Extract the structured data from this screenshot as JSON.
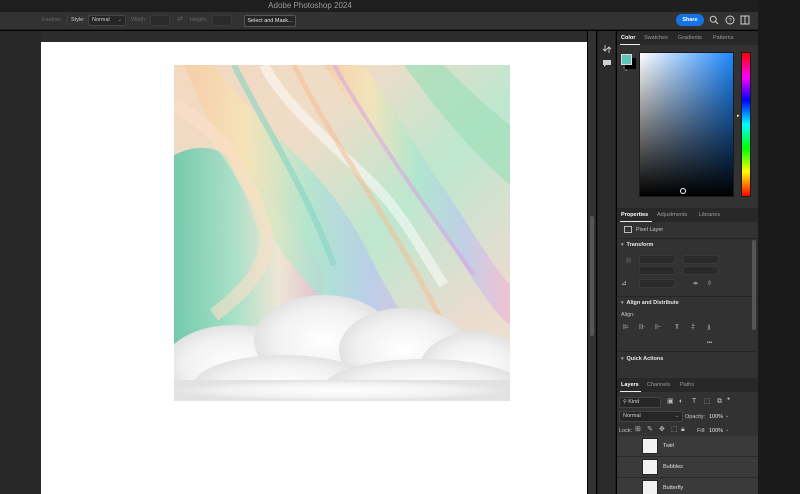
{
  "app": {
    "title": "Adobe Photoshop 2024"
  },
  "options_bar": {
    "feather_label": "Feather:",
    "style_label": "Style:",
    "style_value": "Normal",
    "width_label": "Width:",
    "height_label": "Height:",
    "select_mask_label": "Select and Mask...",
    "share_label": "Share"
  },
  "color_panel": {
    "tabs": [
      "Color",
      "Swatches",
      "Gradients",
      "Patterns"
    ],
    "active_tab": "Color",
    "foreground_color": "#5fc4b8",
    "background_color": "#000000",
    "hue_color": "#1e88ff"
  },
  "properties_panel": {
    "tabs": [
      "Properties",
      "Adjustments",
      "Libraries"
    ],
    "active_tab": "Properties",
    "layer_type": "Pixel Layer",
    "transform_label": "Transform",
    "align_label": "Align and Distribute",
    "align_sub": "Align:",
    "quick_actions_label": "Quick Actions",
    "more": "•••"
  },
  "layers_panel": {
    "tabs": [
      "Layers",
      "Channels",
      "Paths"
    ],
    "active_tab": "Layers",
    "filter_kind": "Kind",
    "blend_mode": "Normal",
    "opacity_label": "Opacity:",
    "opacity_value": "100%",
    "lock_label": "Lock:",
    "fill_label": "Fill:",
    "fill_value": "100%",
    "layers": [
      {
        "name": "Twirl"
      },
      {
        "name": "Bubbles"
      },
      {
        "name": "Butterfly"
      }
    ]
  },
  "icons": {
    "toolbar_right": [
      "search-icon",
      "help-icon",
      "workspace-icon"
    ],
    "toolstrip": [
      "layers-toggle-icon",
      "comment-icon"
    ]
  },
  "colors": {
    "accent": "#1473e6",
    "panel_bg": "#323232",
    "document_bg": "#ffffff"
  }
}
